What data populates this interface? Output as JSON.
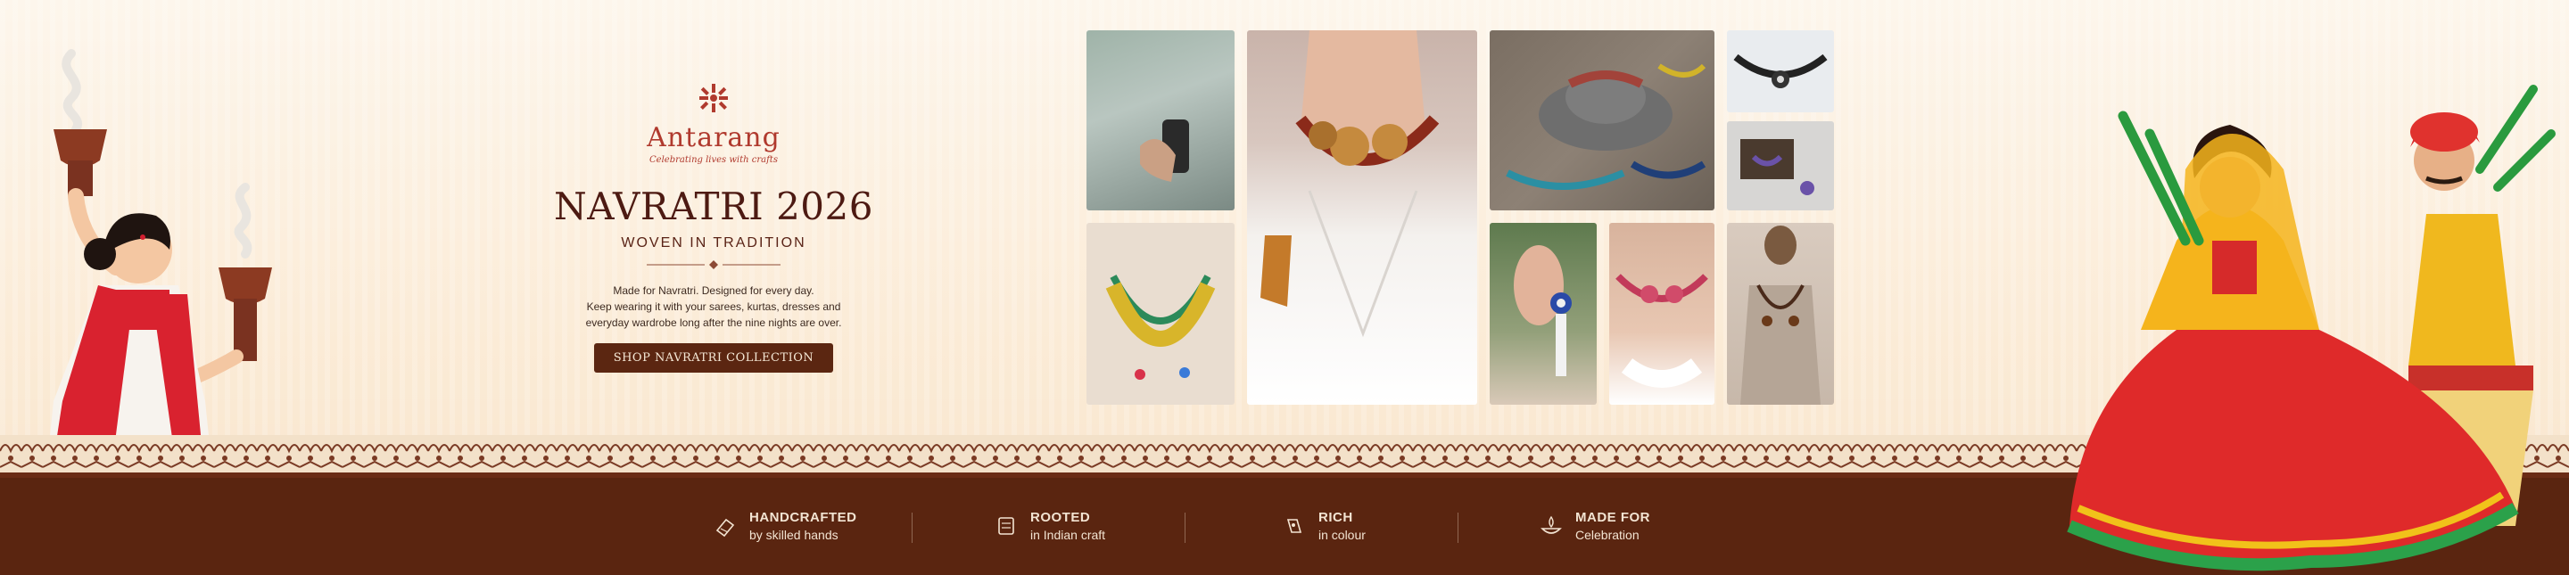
{
  "brand": {
    "name": "Antarang",
    "tagline": "Celebrating lives with crafts"
  },
  "hero": {
    "title": "NAVRATRI 2026",
    "subtitle": "WOVEN IN TRADITION",
    "description_lines": [
      "Made for Navratri. Designed for every day.",
      "Keep wearing it with your sarees, kurtas, dresses and",
      "everyday wardrobe long after the nine nights are over."
    ],
    "cta_label": "SHOP NAVRATRI COLLECTION"
  },
  "features": [
    {
      "icon": "thread-spool-icon",
      "title": "HANDCRAFTED",
      "subtitle": "by skilled hands"
    },
    {
      "icon": "scroll-icon",
      "title": "ROOTED",
      "subtitle": "in Indian craft"
    },
    {
      "icon": "palette-icon",
      "title": "RICH",
      "subtitle": "in colour"
    },
    {
      "icon": "diya-icon",
      "title": "MADE FOR",
      "subtitle": "Celebration"
    }
  ],
  "colors": {
    "brown": "#5a2510",
    "cream": "#fbf0e1",
    "maroon": "#b03a2e",
    "button": "#5b2611"
  }
}
